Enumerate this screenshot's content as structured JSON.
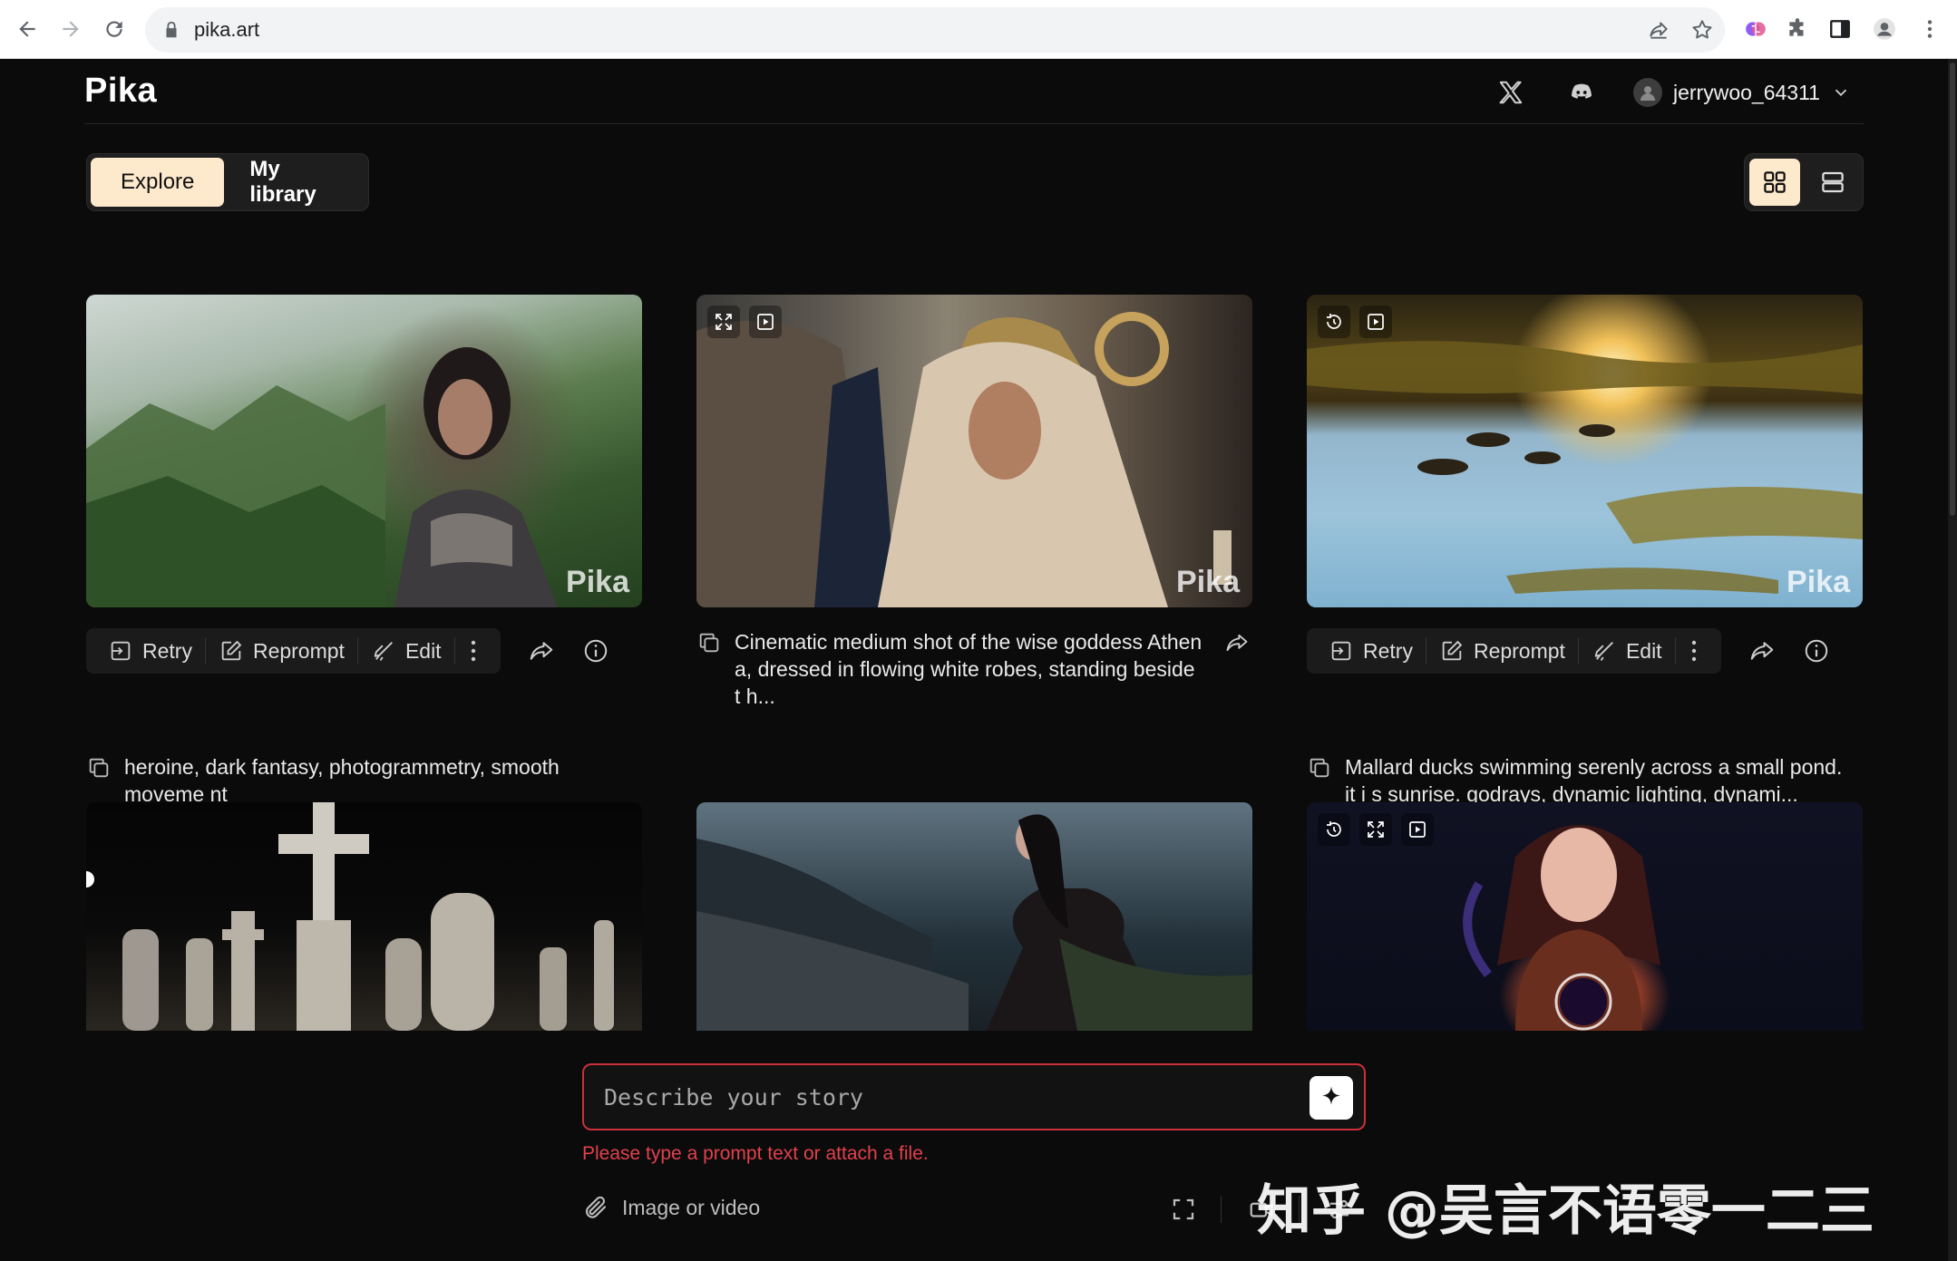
{
  "browser": {
    "url": "pika.art"
  },
  "header": {
    "logo": "Pika",
    "username": "jerrywoo_64311"
  },
  "tabs": [
    {
      "label": "Explore",
      "active": true
    },
    {
      "label": "My library",
      "active": false
    }
  ],
  "actions": {
    "retry": "Retry",
    "reprompt": "Reprompt",
    "edit": "Edit"
  },
  "cards": [
    {
      "watermark": "Pika",
      "prompt": "heroine, dark fantasy, photogrammetry, smooth moveme nt",
      "overlay_icons": []
    },
    {
      "watermark": "Pika",
      "prompt": "Cinematic medium shot of the wise goddess Athen a, dressed in flowing white robes, standing beside t h...",
      "overlay_icons": [
        "expand-icon",
        "play-icon"
      ]
    },
    {
      "watermark": "Pika",
      "prompt": "Mallard ducks swimming serenly across a small pond. it i s sunrise. godrays, dynamic lighting, dynami...",
      "overlay_icons": [
        "timer-icon",
        "play-icon"
      ]
    },
    {
      "watermark": "",
      "prompt": "",
      "overlay_icons": []
    },
    {
      "watermark": "",
      "prompt": "",
      "overlay_icons": []
    },
    {
      "watermark": "",
      "prompt": "",
      "overlay_icons": [
        "timer-icon",
        "expand-icon",
        "play-icon"
      ]
    }
  ],
  "composer": {
    "placeholder": "Describe your story",
    "error": "Please type a prompt text or attach a file.",
    "attach_label": "Image or video"
  },
  "watermark_text": "知乎 @吴言不语零一二三",
  "colors": {
    "accent": "#fde9cc",
    "error": "#e2414c",
    "background": "#0b0b0b"
  }
}
